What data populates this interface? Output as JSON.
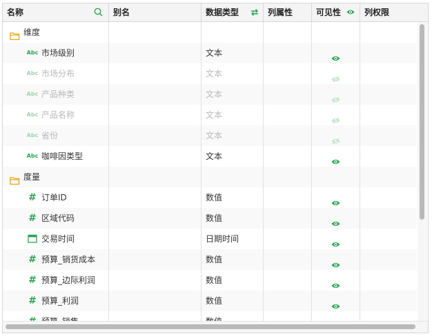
{
  "header": {
    "name": "名称",
    "alias": "别名",
    "data_type": "数据类型",
    "column_attr": "列属性",
    "visibility": "可见性",
    "column_permission": "列权限",
    "icons": {
      "name": "search-icon",
      "data_type": "swap-icon",
      "visibility": "eye-icon"
    }
  },
  "rows": [
    {
      "kind": "group",
      "label": "维度",
      "icon": "folder-icon"
    },
    {
      "kind": "field",
      "field_icon": "Abc",
      "label": "市场级别",
      "type": "文本",
      "visible": true,
      "dim": false
    },
    {
      "kind": "field",
      "field_icon": "Abc",
      "label": "市场分布",
      "type": "文本",
      "visible": false,
      "dim": true
    },
    {
      "kind": "field",
      "field_icon": "Abc",
      "label": "产品种类",
      "type": "文本",
      "visible": false,
      "dim": true
    },
    {
      "kind": "field",
      "field_icon": "Abc",
      "label": "产品名称",
      "type": "文本",
      "visible": false,
      "dim": true
    },
    {
      "kind": "field",
      "field_icon": "Abc",
      "label": "省份",
      "type": "文本",
      "visible": false,
      "dim": true
    },
    {
      "kind": "field",
      "field_icon": "Abc",
      "label": "咖啡因类型",
      "type": "文本",
      "visible": true,
      "dim": false
    },
    {
      "kind": "group",
      "label": "度量",
      "icon": "folder-icon"
    },
    {
      "kind": "field",
      "field_icon": "#",
      "label": "订单ID",
      "type": "数值",
      "visible": true,
      "dim": false
    },
    {
      "kind": "field",
      "field_icon": "#",
      "label": "区域代码",
      "type": "数值",
      "visible": true,
      "dim": false
    },
    {
      "kind": "field",
      "field_icon": "calendar",
      "label": "交易时间",
      "type": "日期时间",
      "visible": true,
      "dim": false
    },
    {
      "kind": "field",
      "field_icon": "#",
      "label": "预算_销货成本",
      "type": "数值",
      "visible": true,
      "dim": false
    },
    {
      "kind": "field",
      "field_icon": "#",
      "label": "预算_边际利润",
      "type": "数值",
      "visible": true,
      "dim": false
    },
    {
      "kind": "field",
      "field_icon": "#",
      "label": "预算_利润",
      "type": "数值",
      "visible": true,
      "dim": false
    },
    {
      "kind": "field",
      "field_icon": "#",
      "label": "预算_销售",
      "type": "数值",
      "visible": true,
      "dim": false
    }
  ],
  "colors": {
    "accent_green": "#2aa452",
    "folder_orange": "#f0a020",
    "header_bg": "#f4f4f4",
    "border": "#d6d6d6"
  }
}
